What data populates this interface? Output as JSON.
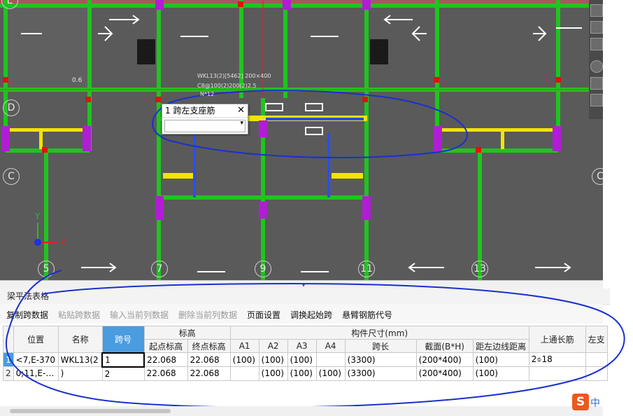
{
  "drawing": {
    "axis_labels": [
      "E",
      "D",
      "C",
      "5",
      "7",
      "9",
      "11",
      "13",
      "C"
    ],
    "labels_small": [
      "WKL13(2)[5462] 200×400",
      "C8@100(2)200(2)2.5",
      "N*12",
      "0.6"
    ],
    "ucs": {
      "x_label": "X",
      "y_label": "Y"
    }
  },
  "popup": {
    "title": "1 跨左支座筋",
    "close": "✕",
    "value": "",
    "dropdown": "▾"
  },
  "divider_grip": "▾",
  "panel": {
    "title": "梁平法表格",
    "toolbar": [
      {
        "label": "复制跨数据",
        "enabled": true
      },
      {
        "label": "粘贴跨数据",
        "enabled": false
      },
      {
        "label": "输入当前列数据",
        "enabled": false
      },
      {
        "label": "删除当前列数据",
        "enabled": false
      },
      {
        "label": "页面设置",
        "enabled": true
      },
      {
        "label": "调换起始跨",
        "enabled": true
      },
      {
        "label": "悬臂钢筋代号",
        "enabled": true
      }
    ],
    "headers": {
      "position": "位置",
      "name": "名称",
      "span_no": "跨号",
      "elevation": "标高",
      "start_elev": "起点标高",
      "end_elev": "终点标高",
      "member_size": "构件尺寸(mm)",
      "a1": "A1",
      "a2": "A2",
      "a3": "A3",
      "a4": "A4",
      "span_len": "跨长",
      "section": "截面(B*H)",
      "dist_left": "距左边线距离",
      "top_through": "上通长筋",
      "left_support": "左支"
    },
    "rows": [
      {
        "row_no": "1",
        "position": "<7,E-370",
        "name": "WKL13(2",
        "span_no": "1",
        "start_elev": "22.068",
        "end_elev": "22.068",
        "a1": "(100)",
        "a2": "(100)",
        "a3": "(100)",
        "a4": "",
        "span_len": "(3300)",
        "section": "(200*400)",
        "dist_left": "(100)",
        "top_through": "2⌽18",
        "left_support": ""
      },
      {
        "row_no": "2",
        "position": "0;11,E-…",
        "name": ")",
        "span_no": "2",
        "start_elev": "22.068",
        "end_elev": "22.068",
        "a1": "",
        "a2": "(100)",
        "a3": "(100)",
        "a4": "(100)",
        "span_len": "(3300)",
        "section": "(200*400)",
        "dist_left": "(100)",
        "top_through": "",
        "left_support": ""
      }
    ]
  },
  "ime": {
    "logo": "S",
    "lang": "中"
  }
}
